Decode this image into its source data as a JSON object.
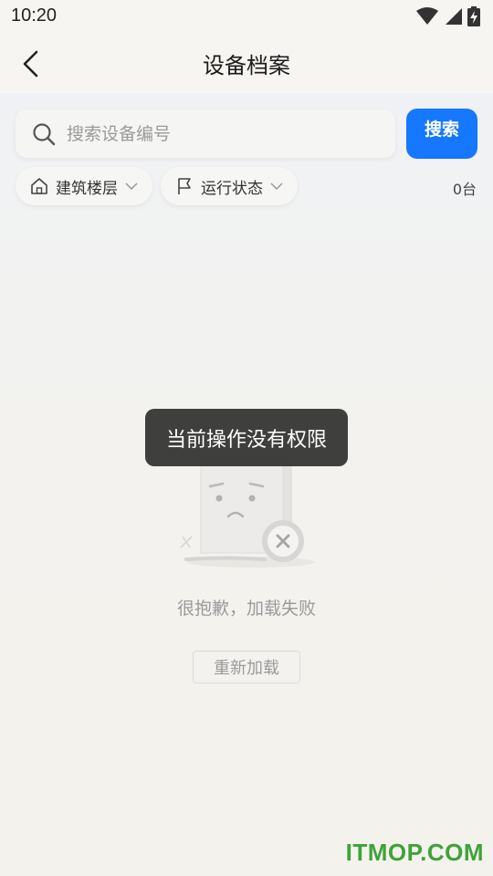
{
  "status_bar": {
    "time": "10:20",
    "icons": [
      "wifi-icon",
      "signal-icon",
      "battery-charging-icon"
    ]
  },
  "nav": {
    "title": "设备档案",
    "back_icon": "chevron-left-icon"
  },
  "search": {
    "placeholder": "搜索设备编号",
    "value": "",
    "button_label": "搜索"
  },
  "filters": {
    "building_label": "建筑楼层",
    "status_label": "运行状态"
  },
  "count_label": "0台",
  "toast": "当前操作没有权限",
  "error": {
    "message": "很抱歉，加载失败",
    "reload_label": "重新加载"
  },
  "watermark": "ITMOP.COM",
  "colors": {
    "accent": "#1677ff",
    "toast_bg": "#30302e",
    "watermark": "#3fa23a"
  }
}
